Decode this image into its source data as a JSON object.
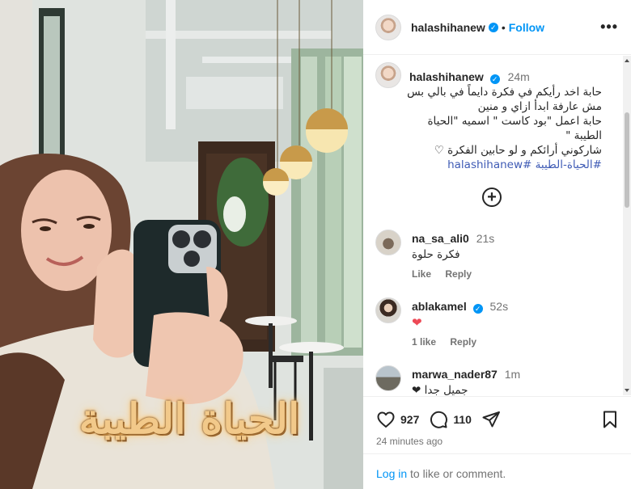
{
  "post": {
    "author": "halashihanew",
    "follow_label": "Follow",
    "more_label": "•••",
    "overlay_text": "الحياة الطيبة"
  },
  "caption": {
    "author": "halashihanew",
    "time": "24m",
    "lines": [
      "حابة اخد رأيكم في فكرة دايماً في بالي بس",
      "مش عارفة ابدأ ازاي و منين",
      "حابة اعمل \"بود كاست \" اسميه \"الحياة",
      "الطيبة \"",
      "شاركوني أرائكم و لو حابين الفكرة ♡"
    ],
    "hashtag_1": "#halashihanew",
    "hashtag_2": "#الحياة-الطيبة"
  },
  "load_more_label": "+",
  "comments": [
    {
      "user": "na_sa_ali0",
      "verified": false,
      "time": "21s",
      "text": "فكرة حلوة",
      "likes": "",
      "like_label": "Like",
      "reply_label": "Reply"
    },
    {
      "user": "ablakamel",
      "verified": true,
      "time": "52s",
      "text": "❤",
      "likes": "1 like",
      "like_label": "",
      "reply_label": "Reply"
    },
    {
      "user": "marwa_nader87",
      "verified": false,
      "time": "1m",
      "text": "جميل جدا ❤",
      "likes": "",
      "like_label": "",
      "reply_label": ""
    }
  ],
  "stats": {
    "likes": "927",
    "comments": "110"
  },
  "posted_ago": "24 minutes ago",
  "login": {
    "link": "Log in",
    "rest": " to like or comment."
  },
  "colors": {
    "accent": "#0095f6",
    "heart": "#ed4956",
    "hashtag": "#3f5bb5"
  }
}
